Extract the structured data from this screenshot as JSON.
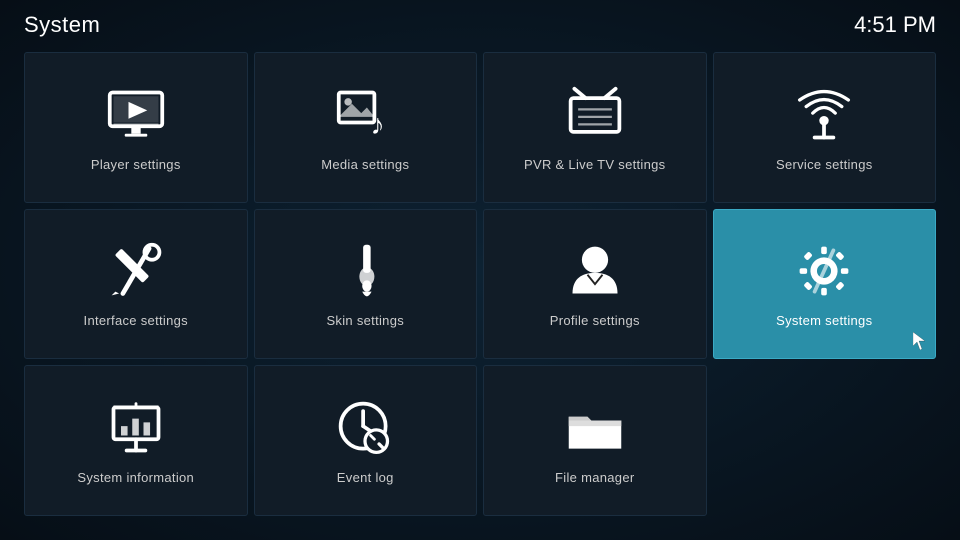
{
  "header": {
    "title": "System",
    "time": "4:51 PM"
  },
  "tiles": [
    {
      "id": "player-settings",
      "label": "Player settings",
      "icon": "player",
      "active": false
    },
    {
      "id": "media-settings",
      "label": "Media settings",
      "icon": "media",
      "active": false
    },
    {
      "id": "pvr-settings",
      "label": "PVR & Live TV settings",
      "icon": "pvr",
      "active": false
    },
    {
      "id": "service-settings",
      "label": "Service settings",
      "icon": "service",
      "active": false
    },
    {
      "id": "interface-settings",
      "label": "Interface settings",
      "icon": "interface",
      "active": false
    },
    {
      "id": "skin-settings",
      "label": "Skin settings",
      "icon": "skin",
      "active": false
    },
    {
      "id": "profile-settings",
      "label": "Profile settings",
      "icon": "profile",
      "active": false
    },
    {
      "id": "system-settings",
      "label": "System settings",
      "icon": "system",
      "active": true
    },
    {
      "id": "system-information",
      "label": "System information",
      "icon": "sysinfo",
      "active": false
    },
    {
      "id": "event-log",
      "label": "Event log",
      "icon": "eventlog",
      "active": false
    },
    {
      "id": "file-manager",
      "label": "File manager",
      "icon": "filemanager",
      "active": false
    }
  ]
}
